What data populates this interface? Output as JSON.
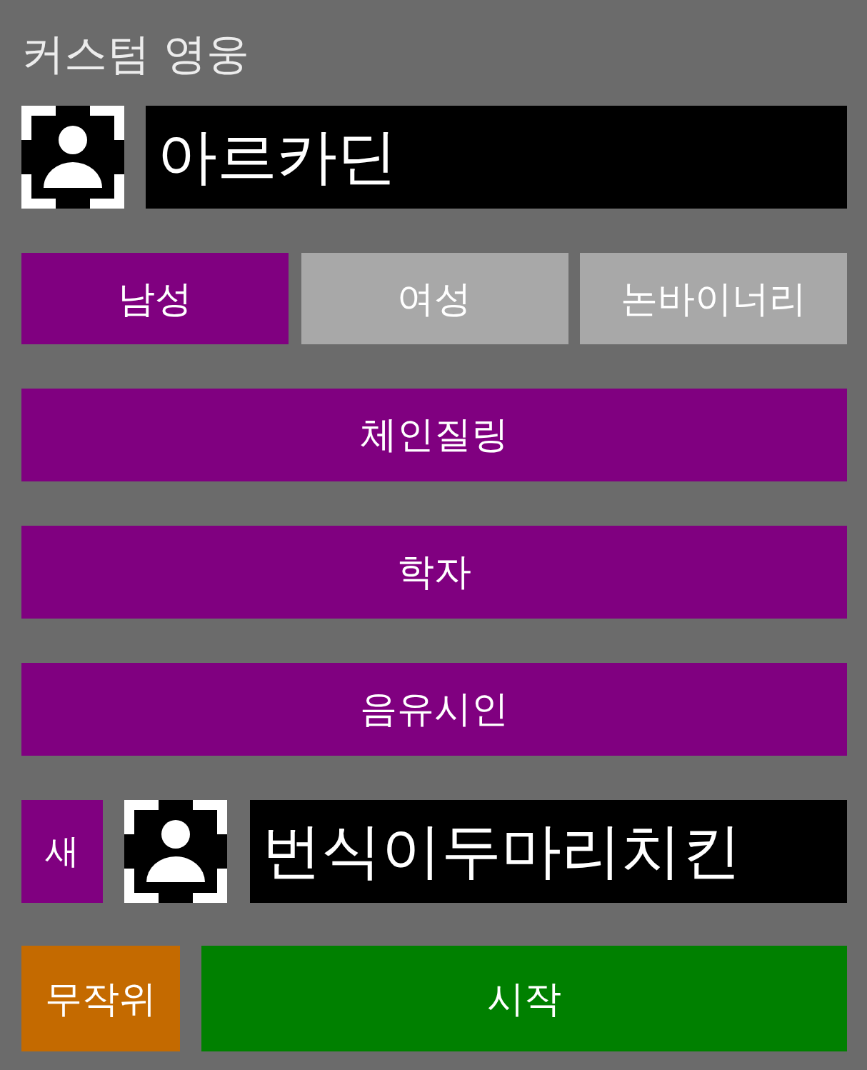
{
  "title": "커스텀 영웅",
  "hero": {
    "name": "아르카딘"
  },
  "genders": [
    {
      "label": "남성",
      "selected": true
    },
    {
      "label": "여성",
      "selected": false
    },
    {
      "label": "논바이너리",
      "selected": false
    }
  ],
  "choices": [
    {
      "label": "체인질링"
    },
    {
      "label": "학자"
    },
    {
      "label": "음유시인"
    }
  ],
  "companion": {
    "button": "새",
    "name": "번식이두마리치킨"
  },
  "actions": [
    {
      "kind": "random",
      "label": "무작위"
    },
    {
      "kind": "start",
      "label": "시작"
    }
  ]
}
